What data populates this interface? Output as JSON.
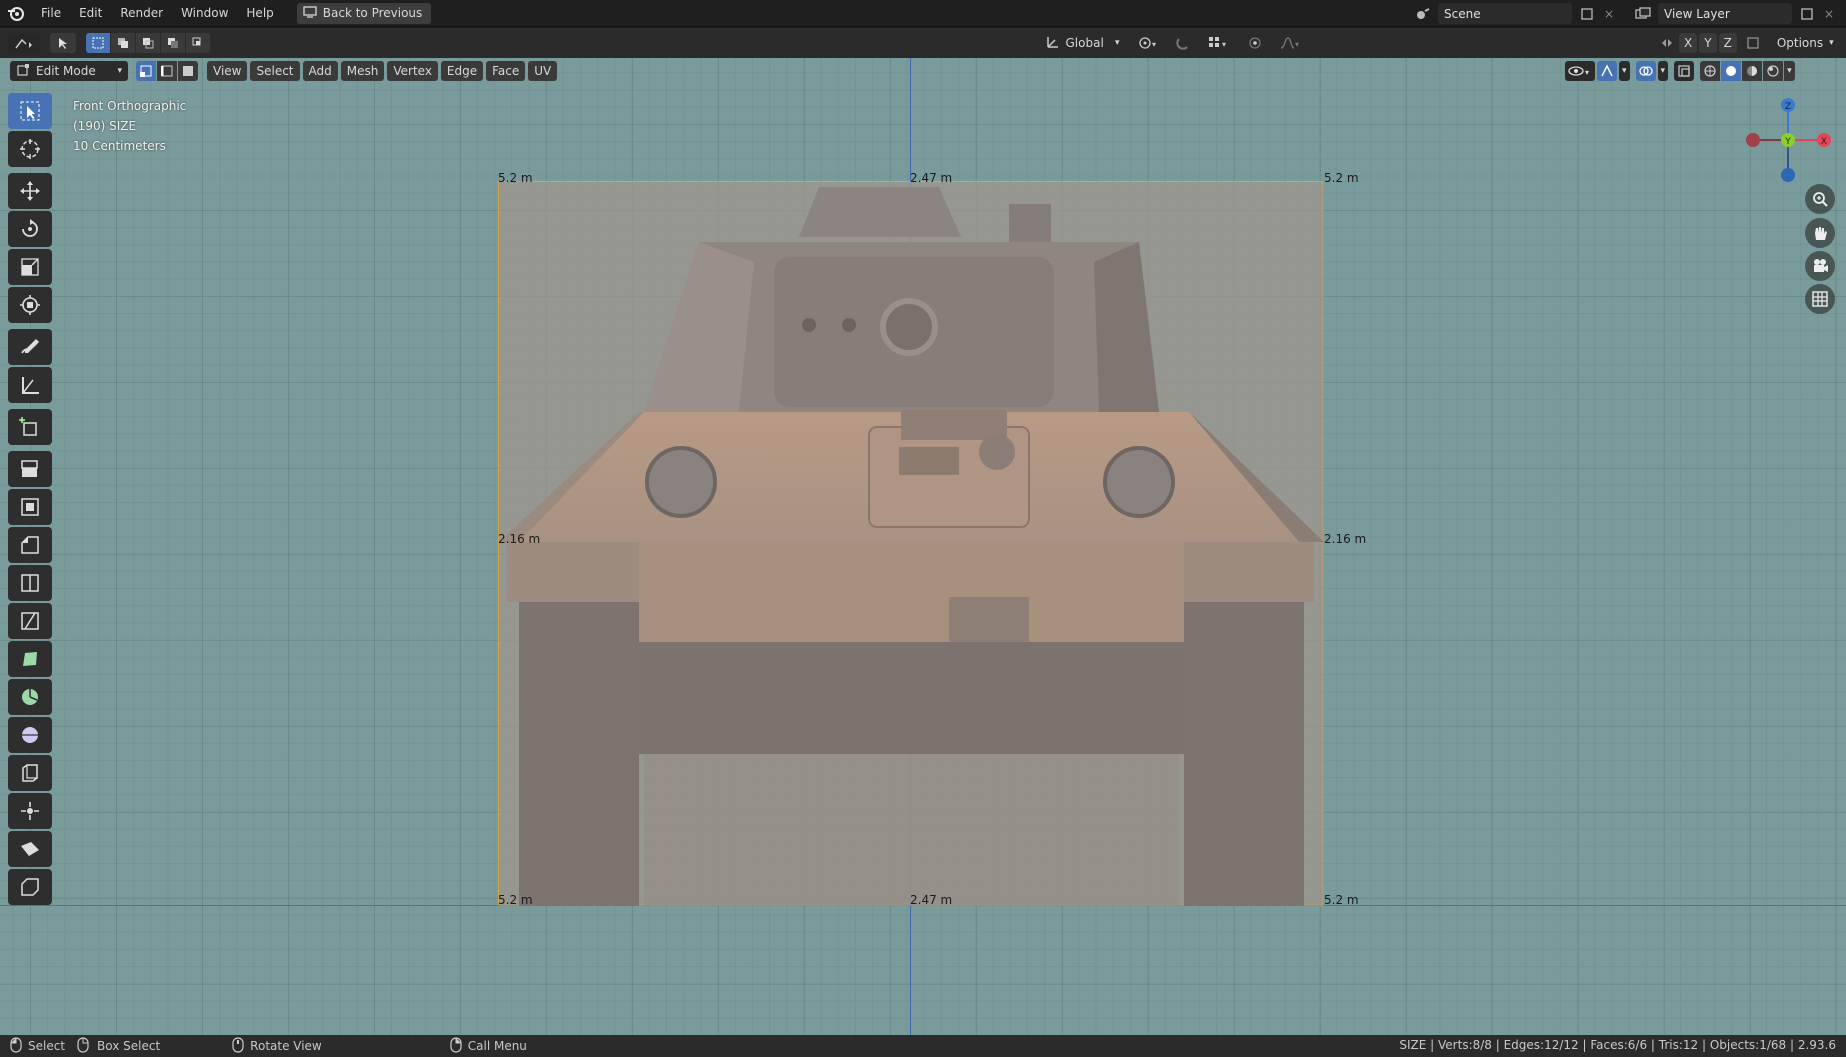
{
  "menu": {
    "items": [
      "File",
      "Edit",
      "Render",
      "Window",
      "Help"
    ],
    "back_button": "Back to Previous"
  },
  "scene": {
    "label": "Scene",
    "view_layer": "View Layer"
  },
  "tool_header": {
    "orientation": "Global",
    "axis_x": "X",
    "axis_y": "Y",
    "axis_z": "Z",
    "options": "Options"
  },
  "header": {
    "mode": "Edit Mode",
    "menus": [
      "View",
      "Select",
      "Add",
      "Mesh",
      "Vertex",
      "Edge",
      "Face",
      "UV"
    ]
  },
  "overlay": {
    "view_name": "Front Orthographic",
    "object": "(190) SIZE",
    "scale": "10 Centimeters"
  },
  "dimensions": {
    "top_left": "5.2 m",
    "top_center": "2.47 m",
    "top_right": "5.2 m",
    "mid_left": "2.16 m",
    "mid_right": "2.16 m",
    "bottom_left": "5.2 m",
    "bottom_center": "2.47 m",
    "bottom_right": "5.2 m"
  },
  "statusbar": {
    "select": "Select",
    "box_select": "Box Select",
    "rotate_view": "Rotate View",
    "call_menu": "Call Menu",
    "stats": "SIZE | Verts:8/8 | Edges:12/12 | Faces:6/6 | Tris:12 | Objects:1/68 | 2.93.6"
  },
  "colors": {
    "viewport_bg": "#7a9b9b",
    "accent": "#4772b3",
    "axis_x": "#e0485a",
    "axis_y": "#8bcf2e",
    "axis_z": "#3b7ad1",
    "selection_outline": "#d6a24a"
  },
  "icons": {
    "toolbar": [
      "select-box-icon",
      "cursor-icon",
      "move-icon",
      "rotate-icon",
      "scale-icon",
      "transform-icon",
      "annotate-icon",
      "measure-icon",
      "add-cube-icon",
      "extrude-icon",
      "inset-icon",
      "bevel-icon",
      "loop-cut-icon",
      "knife-icon",
      "poly-build-icon",
      "spin-icon",
      "smooth-icon",
      "edge-slide-icon",
      "shrink-fatten-icon",
      "shear-icon",
      "rip-icon"
    ]
  }
}
